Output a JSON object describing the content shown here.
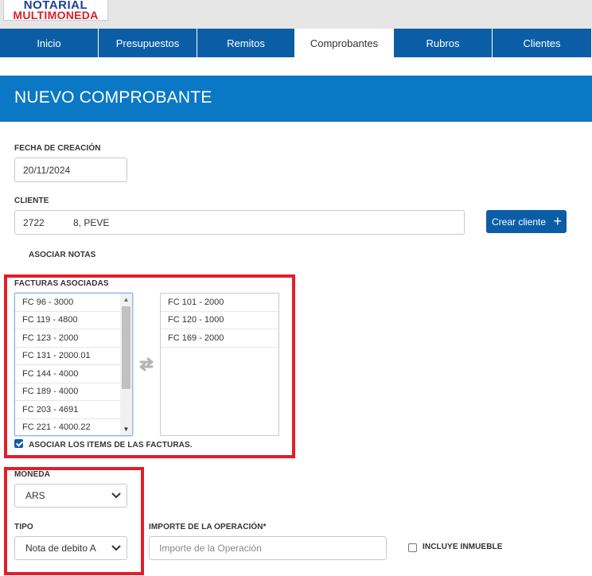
{
  "app": {
    "logo_line1": "NOTARIAL",
    "logo_line2": "MULTIMONEDA"
  },
  "nav": {
    "tabs": [
      {
        "label": "Inicio",
        "active": false
      },
      {
        "label": "Presupuestos",
        "active": false
      },
      {
        "label": "Remitos",
        "active": false
      },
      {
        "label": "Comprobantes",
        "active": true
      },
      {
        "label": "Rubros",
        "active": false
      },
      {
        "label": "Clientes",
        "active": false
      }
    ]
  },
  "page": {
    "title": "NUEVO COMPROBANTE"
  },
  "form": {
    "fecha_label": "FECHA DE CREACIÓN",
    "fecha_value": "20/11/2024",
    "cliente_label": "CLIENTE",
    "cliente_value_a": "2722",
    "cliente_value_b": "8, PEVE",
    "crear_cliente_label": "Crear cliente",
    "asociar_notas_label": "ASOCIAR NOTAS",
    "facturas_label": "FACTURAS ASOCIADAS",
    "available_invoices": [
      "FC 96 - 3000",
      "FC 119 - 4800",
      "FC 123 - 2000",
      "FC 131 - 2000.01",
      "FC 144 - 4000",
      "FC 189 - 4000",
      "FC 203 - 4691",
      "FC 221 - 4000.22"
    ],
    "selected_invoices": [
      "FC 101 - 2000",
      "FC 120 - 1000",
      "FC 169 - 2000"
    ],
    "asociar_items_label": "ASOCIAR LOS ITEMS DE LAS FACTURAS.",
    "asociar_items_checked": true,
    "moneda_label": "MONEDA",
    "moneda_value": "ARS",
    "tipo_label": "TIPO",
    "tipo_value": "Nota de debito A",
    "importe_label": "IMPORTE DE LA OPERACIÓN*",
    "importe_placeholder": "Importe de la Operación",
    "incluye_inmueble_label": "INCLUYE INMUEBLE",
    "incluye_inmueble_checked": false
  },
  "colors": {
    "nav_blue": "#0b5ea6",
    "banner_blue": "#0b78c5",
    "highlight_red": "#e01e2b",
    "logo_blue": "#1c3f95",
    "logo_red": "#d81e2c"
  }
}
